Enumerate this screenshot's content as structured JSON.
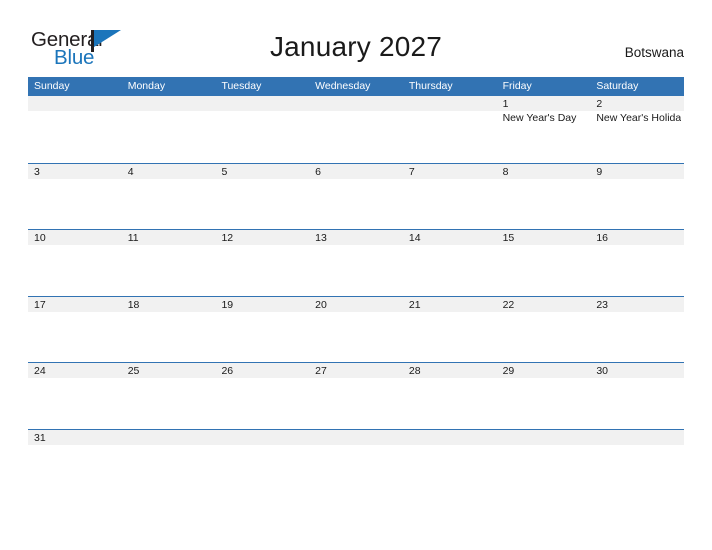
{
  "brand": {
    "word_one": "General",
    "word_two": "Blue",
    "flag_icon": "flag-icon"
  },
  "header": {
    "title": "January 2027",
    "country": "Botswana"
  },
  "colors": {
    "header_blue": "#3273B3",
    "brand_blue": "#1b75bb",
    "band_gray": "#f1f1f1",
    "text": "#1a1a1a"
  },
  "calendar": {
    "weekday_headers": [
      "Sunday",
      "Monday",
      "Tuesday",
      "Wednesday",
      "Thursday",
      "Friday",
      "Saturday"
    ],
    "weeks": [
      {
        "days": [
          {
            "num": "",
            "events": []
          },
          {
            "num": "",
            "events": []
          },
          {
            "num": "",
            "events": []
          },
          {
            "num": "",
            "events": []
          },
          {
            "num": "",
            "events": []
          },
          {
            "num": "1",
            "events": [
              "New Year's Day"
            ]
          },
          {
            "num": "2",
            "events": [
              "New Year's Holiday"
            ]
          }
        ]
      },
      {
        "days": [
          {
            "num": "3",
            "events": []
          },
          {
            "num": "4",
            "events": []
          },
          {
            "num": "5",
            "events": []
          },
          {
            "num": "6",
            "events": []
          },
          {
            "num": "7",
            "events": []
          },
          {
            "num": "8",
            "events": []
          },
          {
            "num": "9",
            "events": []
          }
        ]
      },
      {
        "days": [
          {
            "num": "10",
            "events": []
          },
          {
            "num": "11",
            "events": []
          },
          {
            "num": "12",
            "events": []
          },
          {
            "num": "13",
            "events": []
          },
          {
            "num": "14",
            "events": []
          },
          {
            "num": "15",
            "events": []
          },
          {
            "num": "16",
            "events": []
          }
        ]
      },
      {
        "days": [
          {
            "num": "17",
            "events": []
          },
          {
            "num": "18",
            "events": []
          },
          {
            "num": "19",
            "events": []
          },
          {
            "num": "20",
            "events": []
          },
          {
            "num": "21",
            "events": []
          },
          {
            "num": "22",
            "events": []
          },
          {
            "num": "23",
            "events": []
          }
        ]
      },
      {
        "days": [
          {
            "num": "24",
            "events": []
          },
          {
            "num": "25",
            "events": []
          },
          {
            "num": "26",
            "events": []
          },
          {
            "num": "27",
            "events": []
          },
          {
            "num": "28",
            "events": []
          },
          {
            "num": "29",
            "events": []
          },
          {
            "num": "30",
            "events": []
          }
        ]
      },
      {
        "days": [
          {
            "num": "31",
            "events": []
          },
          {
            "num": "",
            "events": []
          },
          {
            "num": "",
            "events": []
          },
          {
            "num": "",
            "events": []
          },
          {
            "num": "",
            "events": []
          },
          {
            "num": "",
            "events": []
          },
          {
            "num": "",
            "events": []
          }
        ]
      }
    ]
  }
}
